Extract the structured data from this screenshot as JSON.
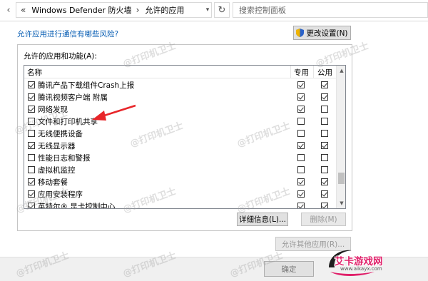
{
  "address_bar": {
    "breadcrumb_prefix": "«",
    "crumb_1": "Windows Defender 防火墙",
    "crumb_sep": "›",
    "crumb_2": "允许的应用",
    "refresh_icon": "refresh-icon",
    "search_placeholder": "搜索控制面板"
  },
  "content": {
    "risk_link": "允许应用进行通信有哪些风险?",
    "change_settings_button": "更改设置(N)",
    "group_title": "允许的应用和功能(A):",
    "columns": {
      "name": "名称",
      "private": "专用",
      "public": "公用"
    },
    "rows": [
      {
        "name": "腾讯产品下载组件Crash上报",
        "enabled": true,
        "private": true,
        "public": true
      },
      {
        "name": "腾讯视频客户端 附属",
        "enabled": true,
        "private": true,
        "public": true
      },
      {
        "name": "网络发现",
        "enabled": true,
        "private": true,
        "public": false
      },
      {
        "name": "文件和打印机共享",
        "enabled": false,
        "private": false,
        "public": false
      },
      {
        "name": "无线便携设备",
        "enabled": false,
        "private": false,
        "public": false
      },
      {
        "name": "无线显示器",
        "enabled": true,
        "private": true,
        "public": true
      },
      {
        "name": "性能日志和警报",
        "enabled": false,
        "private": false,
        "public": false
      },
      {
        "name": "虚拟机监控",
        "enabled": false,
        "private": false,
        "public": false
      },
      {
        "name": "移动套餐",
        "enabled": true,
        "private": true,
        "public": true
      },
      {
        "name": "应用安装程序",
        "enabled": true,
        "private": true,
        "public": true
      },
      {
        "name": "英特尔® 显卡控制中心",
        "enabled": true,
        "private": true,
        "public": true
      }
    ],
    "details_button": "详细信息(L)...",
    "remove_button": "删除(M)",
    "allow_other_button": "允许其他应用(R)...",
    "ok_button": "确定"
  },
  "watermark_text": "@打印机卫士",
  "logo": {
    "text": "艾卡游戏网",
    "sub": "www.aikayx.com"
  },
  "colors": {
    "link": "#0a5fb4",
    "arrow": "#e8262a",
    "logo": "#e0206a"
  }
}
